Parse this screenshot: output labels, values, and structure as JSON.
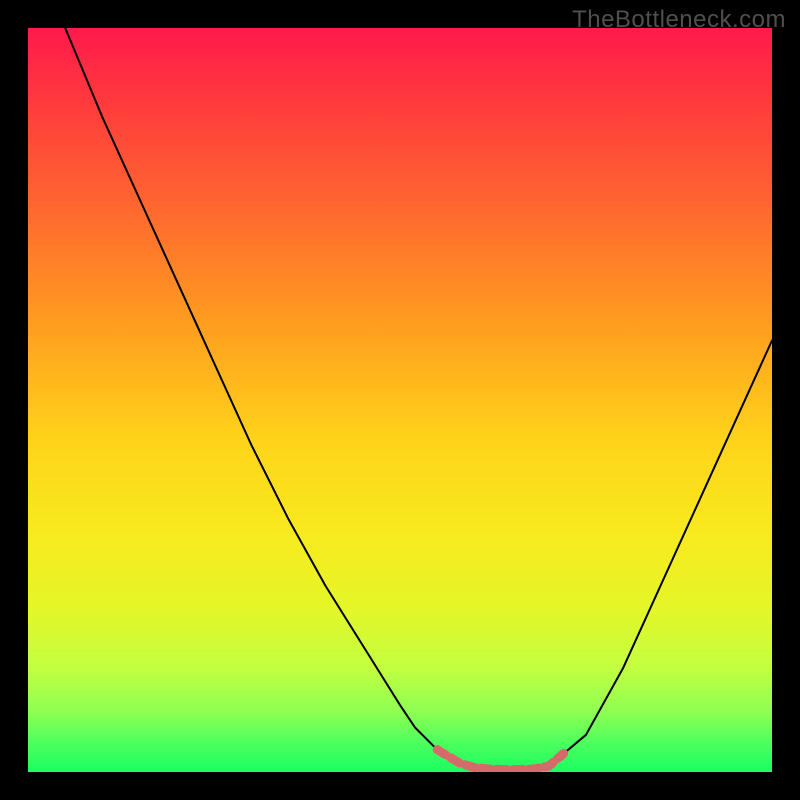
{
  "watermark": "TheBottleneck.com",
  "colors": {
    "gradient_top": "#ff1a4b",
    "gradient_mid": "#ffd21a",
    "gradient_bottom": "#1aff60",
    "curve": "#000000",
    "highlight": "#d66a6a",
    "background": "#000000"
  },
  "chart_data": {
    "type": "line",
    "title": "",
    "xlabel": "",
    "ylabel": "",
    "xlim": [
      0,
      100
    ],
    "ylim": [
      0,
      100
    ],
    "x": [
      0,
      2,
      5,
      10,
      15,
      20,
      25,
      30,
      35,
      40,
      45,
      50,
      52,
      55,
      58,
      60,
      62,
      65,
      68,
      70,
      75,
      80,
      85,
      90,
      95,
      100
    ],
    "values": [
      115,
      108,
      100,
      88,
      77,
      66,
      55,
      44,
      34,
      25,
      17,
      9,
      6,
      3,
      1.2,
      0.6,
      0.4,
      0.3,
      0.4,
      0.8,
      5,
      14,
      25,
      36,
      47,
      58
    ],
    "comment": "values are percentage above the plot floor; 0 is bottom edge, 100 is top. Two curve arms descend into a flat minimum around x≈60–68.",
    "highlight_segments": {
      "comment": "coral-colored dotted/bold strokes where curve nearly touches the bottom band",
      "points": [
        {
          "x": 55,
          "y": 3
        },
        {
          "x": 58,
          "y": 1.2
        },
        {
          "x": 60,
          "y": 0.6
        },
        {
          "x": 62,
          "y": 0.4
        },
        {
          "x": 65,
          "y": 0.3
        },
        {
          "x": 68,
          "y": 0.4
        },
        {
          "x": 70,
          "y": 0.8
        },
        {
          "x": 72,
          "y": 2.5
        }
      ],
      "stroke_width": 9
    }
  }
}
